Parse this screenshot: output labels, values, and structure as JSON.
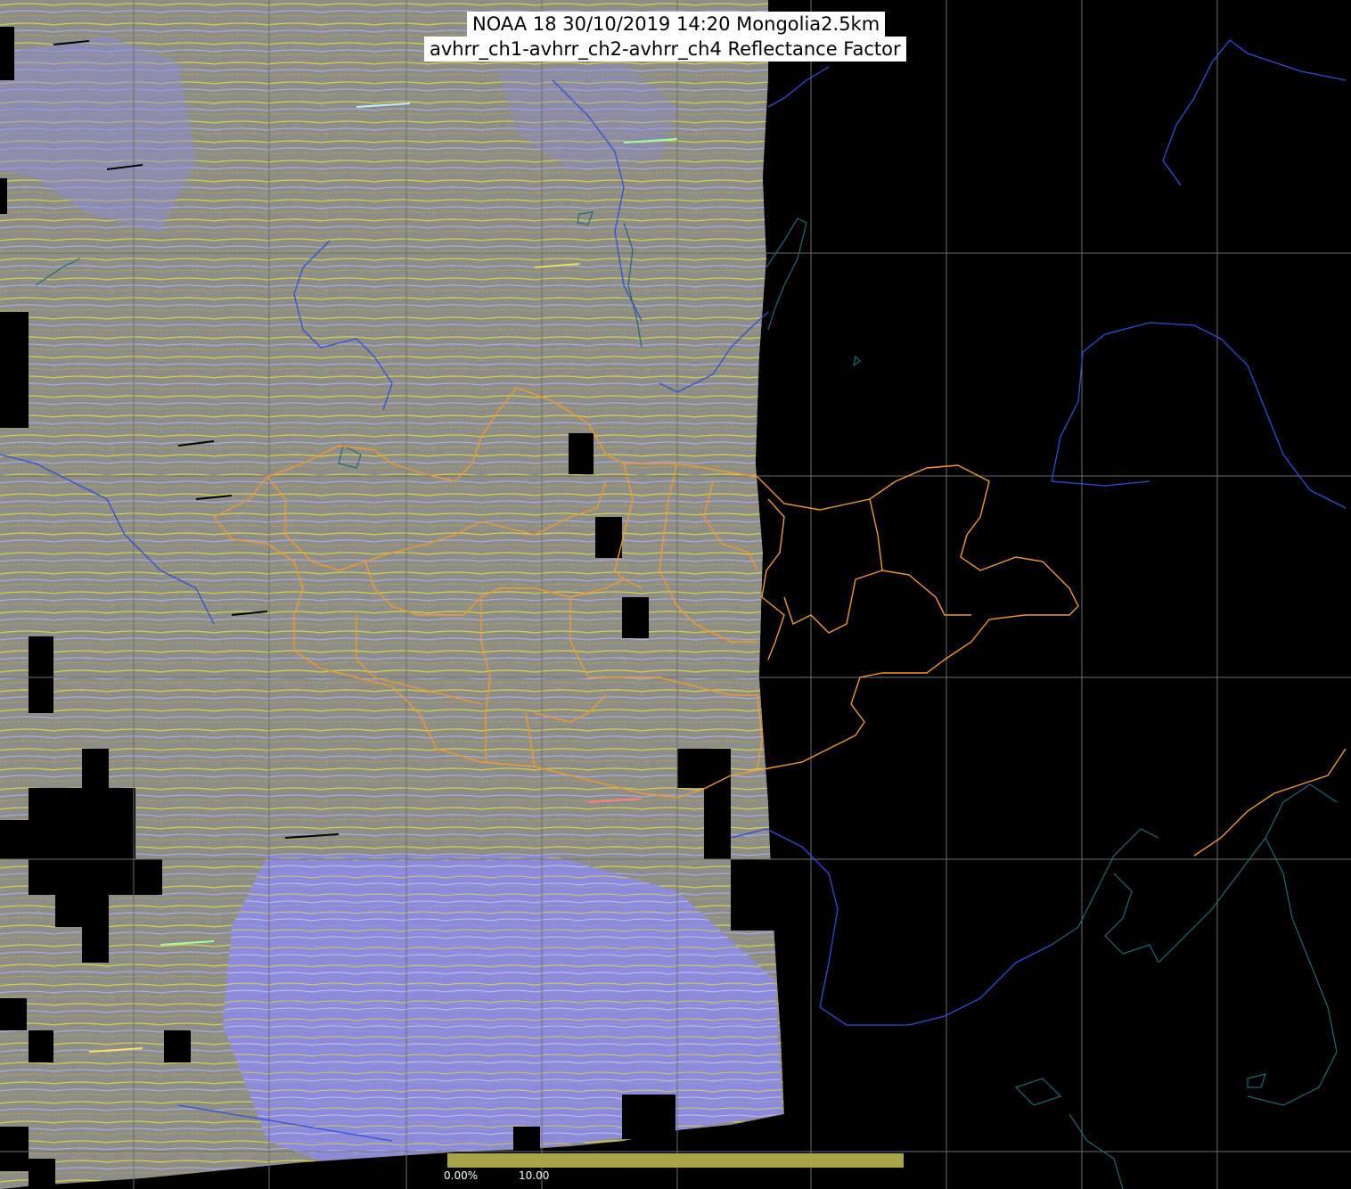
{
  "title": {
    "line1": "NOAA 18 30/10/2019 14:20 Mongolia2.5km",
    "line2": "avhrr_ch1-avhrr_ch2-avhrr_ch4 Reflectance Factor"
  },
  "colorbar": {
    "min_label": "0.00%",
    "mid_label": "10.00",
    "color": "#a8a24a"
  },
  "colors": {
    "background": "#000000",
    "swath": "#8f8f86",
    "swath_blue": "#8c8cf0",
    "grid": "#6e6e6e",
    "rivers": "#2f4fd6",
    "coast": "#1f6a78",
    "borders": "#f09a30",
    "lakes": "#1a7f7f"
  },
  "map": {
    "projection": "lat-lon grid",
    "layers": [
      "satellite-swath",
      "graticule",
      "rivers",
      "coastlines",
      "admin-borders"
    ]
  }
}
